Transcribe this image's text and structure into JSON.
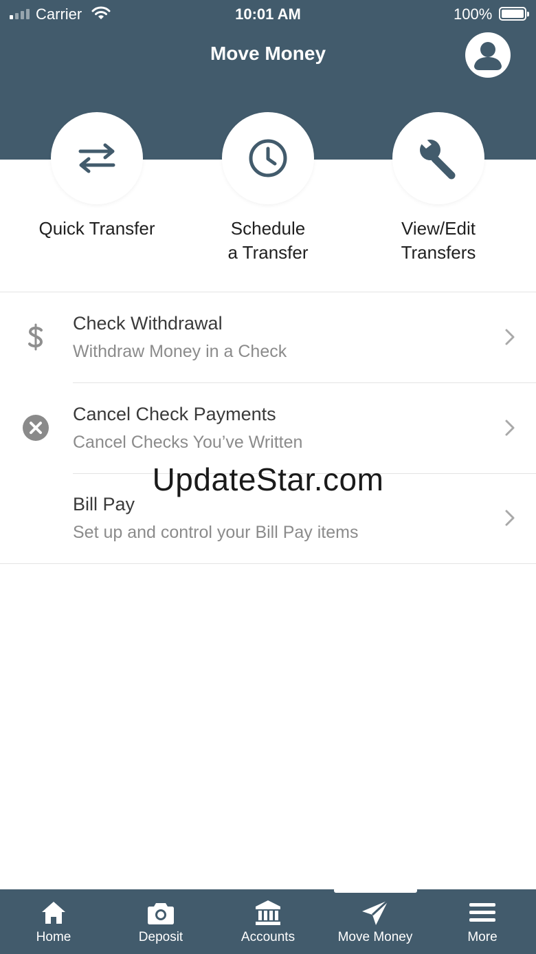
{
  "status_bar": {
    "carrier": "Carrier",
    "time": "10:01 AM",
    "battery": "100%"
  },
  "header": {
    "title": "Move Money",
    "background": "#425b6c",
    "profile_icon": "user-circle-icon"
  },
  "actions": [
    {
      "line1": "Quick Transfer",
      "line2": "",
      "icon": "transfer-arrows-icon"
    },
    {
      "line1": "Schedule",
      "line2": "a Transfer",
      "icon": "clock-icon"
    },
    {
      "line1": "View/Edit",
      "line2": "Transfers",
      "icon": "wrench-icon"
    }
  ],
  "menu": [
    {
      "title": "Check Withdrawal",
      "subtitle": "Withdraw Money in a Check",
      "icon": "dollar-icon"
    },
    {
      "title": "Cancel Check Payments",
      "subtitle": "Cancel Checks You’ve Written",
      "icon": "cancel-circle-icon"
    },
    {
      "title": "Bill Pay",
      "subtitle": "Set up and control your Bill Pay items",
      "icon": ""
    }
  ],
  "watermark": "UpdateStar.com",
  "tabs": [
    {
      "label": "Home",
      "icon": "home-icon"
    },
    {
      "label": "Deposit",
      "icon": "camera-icon"
    },
    {
      "label": "Accounts",
      "icon": "bank-icon"
    },
    {
      "label": "Move Money",
      "icon": "paper-plane-icon",
      "active": true
    },
    {
      "label": "More",
      "icon": "hamburger-menu-icon"
    }
  ]
}
